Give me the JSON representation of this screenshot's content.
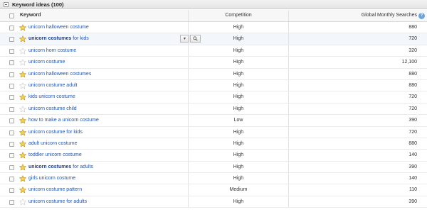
{
  "panel": {
    "title": "Keyword ideas (100)"
  },
  "columns": {
    "keyword": "Keyword",
    "competition": "Competition",
    "searches": "Global Monthly Searches"
  },
  "help_symbol": "?",
  "icons": {
    "collapse": "collapse-icon",
    "star": "star-icon",
    "dropdown": "dropdown-arrow-icon",
    "search": "magnifier-icon",
    "help": "help-icon"
  },
  "colors": {
    "star_yellow": "#e5b820",
    "star_gray": "#c9c9c9",
    "link": "#2255aa",
    "highlight_row": "#f3f6fb"
  },
  "rows": [
    {
      "pre": "",
      "bold": "",
      "text": "unicorn halloween costume",
      "competition": "High",
      "searches": "880",
      "starred": true
    },
    {
      "pre": "",
      "bold": "unicorn costumes",
      "text": " for kids",
      "competition": "High",
      "searches": "720",
      "starred": true,
      "highlighted": true,
      "tools": true
    },
    {
      "pre": "",
      "bold": "",
      "text": "unicorn horn costume",
      "competition": "High",
      "searches": "320",
      "starred": false
    },
    {
      "pre": "",
      "bold": "",
      "text": "unicorn costume",
      "competition": "High",
      "searches": "12,100",
      "starred": false
    },
    {
      "pre": "",
      "bold": "",
      "text": "unicorn halloween costumes",
      "competition": "High",
      "searches": "880",
      "starred": true
    },
    {
      "pre": "",
      "bold": "",
      "text": "unicorn costume adult",
      "competition": "High",
      "searches": "880",
      "starred": false
    },
    {
      "pre": "",
      "bold": "",
      "text": "kids unicorn costume",
      "competition": "High",
      "searches": "720",
      "starred": true
    },
    {
      "pre": "",
      "bold": "",
      "text": "unicorn costume child",
      "competition": "High",
      "searches": "720",
      "starred": false
    },
    {
      "pre": "",
      "bold": "",
      "text": "how to make a unicorn costume",
      "competition": "Low",
      "searches": "390",
      "starred": true
    },
    {
      "pre": "",
      "bold": "",
      "text": "unicorn costume for kids",
      "competition": "High",
      "searches": "720",
      "starred": true
    },
    {
      "pre": "",
      "bold": "",
      "text": "adult unicorn costume",
      "competition": "High",
      "searches": "880",
      "starred": true
    },
    {
      "pre": "",
      "bold": "",
      "text": "toddler unicorn costume",
      "competition": "High",
      "searches": "140",
      "starred": true
    },
    {
      "pre": "",
      "bold": "unicorn costumes",
      "text": " for adults",
      "competition": "High",
      "searches": "390",
      "starred": true
    },
    {
      "pre": "",
      "bold": "",
      "text": "girls unicorn costume",
      "competition": "High",
      "searches": "140",
      "starred": true
    },
    {
      "pre": "",
      "bold": "",
      "text": "unicorn costume pattern",
      "competition": "Medium",
      "searches": "110",
      "starred": true
    },
    {
      "pre": "",
      "bold": "",
      "text": "unicorn costume for adults",
      "competition": "High",
      "searches": "390",
      "starred": false
    }
  ]
}
